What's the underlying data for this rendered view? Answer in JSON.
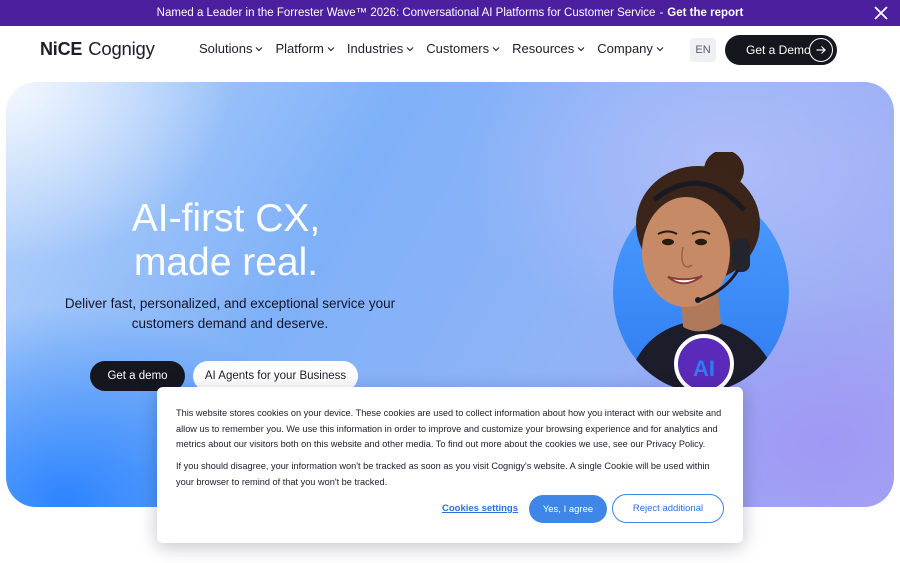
{
  "announcement": {
    "text": "Named a Leader in the Forrester Wave™ 2026: Conversational AI Platforms for Customer Service",
    "separator": "-",
    "link": "Get the report"
  },
  "nav": {
    "logo_nice": "NiCE",
    "logo_cognigy": "Cognigy",
    "items": [
      {
        "label": "Solutions"
      },
      {
        "label": "Platform"
      },
      {
        "label": "Industries"
      },
      {
        "label": "Customers"
      },
      {
        "label": "Resources"
      },
      {
        "label": "Company"
      }
    ],
    "language": "EN",
    "cta": "Get a Demo"
  },
  "hero": {
    "title_line1": "AI-first CX,",
    "title_line2": "made real.",
    "subtitle": "Deliver fast, personalized, and exceptional service your customers demand and deserve.",
    "primary_button": "Get a demo",
    "secondary_button": "AI Agents for your Business",
    "badge_text": "AI"
  },
  "cookie_banner": {
    "paragraph1": "This website stores cookies on your device. These cookies are used to collect information about how you interact with our website and allow us to remember you. We use this information in order to improve and customize your browsing experience and for analytics and metrics about our visitors both on this website and other media. To find out more about the cookies we use, see our Privacy Policy.",
    "paragraph2": "If you should disagree, your information won't be tracked as soon as you visit Cognigy's website. A single Cookie will be used within your browser to remind of that you won't be tracked.",
    "settings_label": "Cookies settings",
    "accept_label": "Yes, I agree",
    "reject_label": "Reject additional"
  },
  "colors": {
    "announcement_bg": "#4b1f9e",
    "dark_button": "#16161f",
    "accent_blue": "#3f86e9"
  },
  "icons": [
    "close-icon",
    "chevron-down-icon",
    "arrow-right-icon"
  ]
}
